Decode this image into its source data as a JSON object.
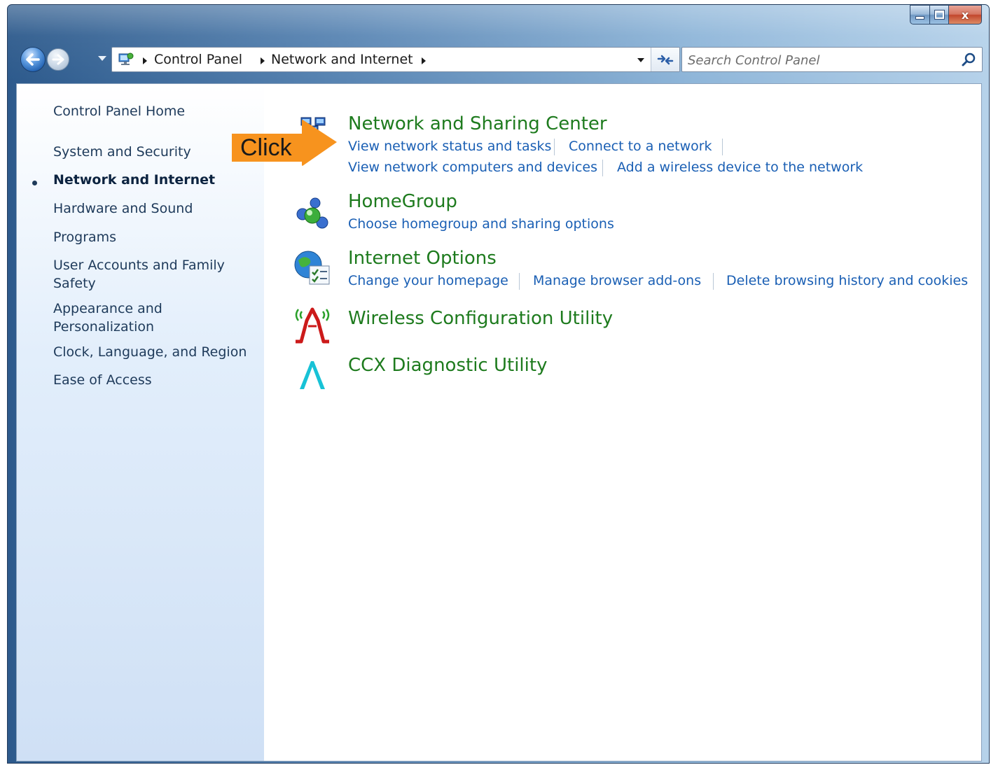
{
  "window": {
    "caption_buttons": [
      "minimize",
      "maximize",
      "close"
    ],
    "close_glyph": "x"
  },
  "address_bar": {
    "breadcrumbs": [
      "Control Panel",
      "Network and Internet"
    ],
    "icon": "control-panel-icon"
  },
  "search": {
    "placeholder": "Search Control Panel"
  },
  "sidebar": {
    "items": [
      {
        "label": "Control Panel Home",
        "active": false
      },
      {
        "label": "System and Security",
        "active": false
      },
      {
        "label": "Network and Internet",
        "active": true
      },
      {
        "label": "Hardware and Sound",
        "active": false
      },
      {
        "label": "Programs",
        "active": false
      },
      {
        "label": "User Accounts and Family",
        "label2": "Safety",
        "active": false
      },
      {
        "label": "Appearance and",
        "label2": "Personalization",
        "active": false
      },
      {
        "label": "Clock, Language, and Region",
        "active": false
      },
      {
        "label": "Ease of Access",
        "active": false
      }
    ]
  },
  "categories": [
    {
      "title": "Network and Sharing Center",
      "icon": "network-sharing-icon",
      "tasks": [
        "View network status and tasks",
        "Connect to a network",
        "View network computers and devices",
        "Add a wireless device to the network"
      ]
    },
    {
      "title": "HomeGroup",
      "icon": "homegroup-icon",
      "tasks": [
        "Choose homegroup and sharing options"
      ]
    },
    {
      "title": "Internet Options",
      "icon": "internet-options-icon",
      "tasks": [
        "Change your homepage",
        "Manage browser add-ons",
        "Delete browsing history and cookies"
      ]
    },
    {
      "title": "Wireless Configuration Utility",
      "icon": "wireless-utility-icon",
      "tasks": []
    },
    {
      "title": "CCX Diagnostic Utility",
      "icon": "ccx-icon",
      "tasks": []
    }
  ],
  "callout": {
    "label": "Click",
    "color": "#f7931e"
  },
  "colors": {
    "category_title": "#1e7b1e",
    "task_link": "#1a5fb4"
  }
}
